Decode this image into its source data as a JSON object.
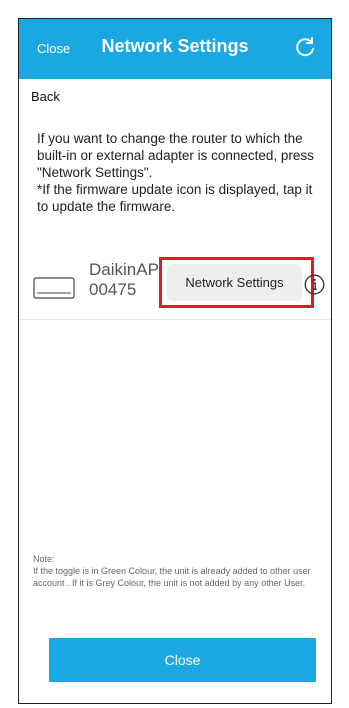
{
  "header": {
    "close_label": "Close",
    "title": "Network Settings",
    "refresh_icon": "refresh-icon"
  },
  "back_label": "Back",
  "instructions": "If you want to change the router to which the built-in or external adapter is connected, press \"Network Settings\".\n*If the firmware update icon is displayed, tap it to update the firmware.",
  "device": {
    "icon": "air-conditioner-icon",
    "name": "DaikinAP\n00475",
    "button_label": "Network Settings",
    "highlight_color": "#e01b22",
    "info_icon": "info-icon"
  },
  "note": "Note:\nIf the toggle is in Green Colour, the unit is already added to other user account . If it is Grey Colour, the unit is not added by any other User.",
  "footer": {
    "close_label": "Close"
  },
  "colors": {
    "accent": "#1aa7e2",
    "highlight": "#e01b22"
  }
}
